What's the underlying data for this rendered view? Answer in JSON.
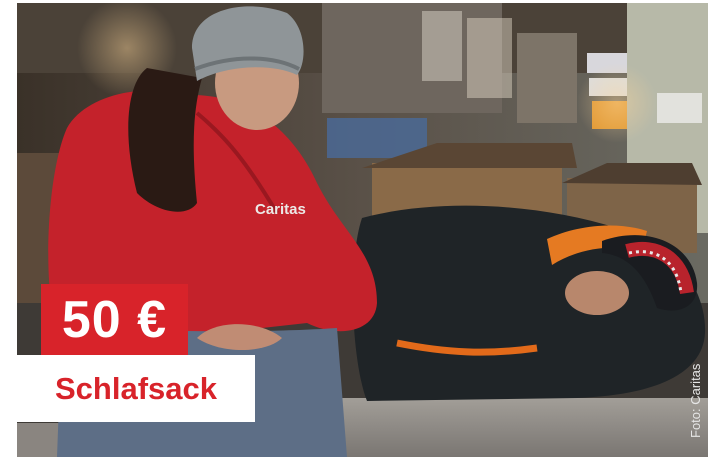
{
  "badge": {
    "price": "50 €",
    "item": "Schlafsack"
  },
  "photo": {
    "credit": "Foto: Caritas",
    "jacket_text": "Caritas",
    "subject": "caritas-helper-and-sleeping-person",
    "colors": {
      "jacket": "#c4222b",
      "sleeping_bag": "#1f2427",
      "orange_trim": "#e26a1a",
      "pavement": "#8d8a86"
    }
  },
  "colors": {
    "brand_red": "#d8232a"
  }
}
